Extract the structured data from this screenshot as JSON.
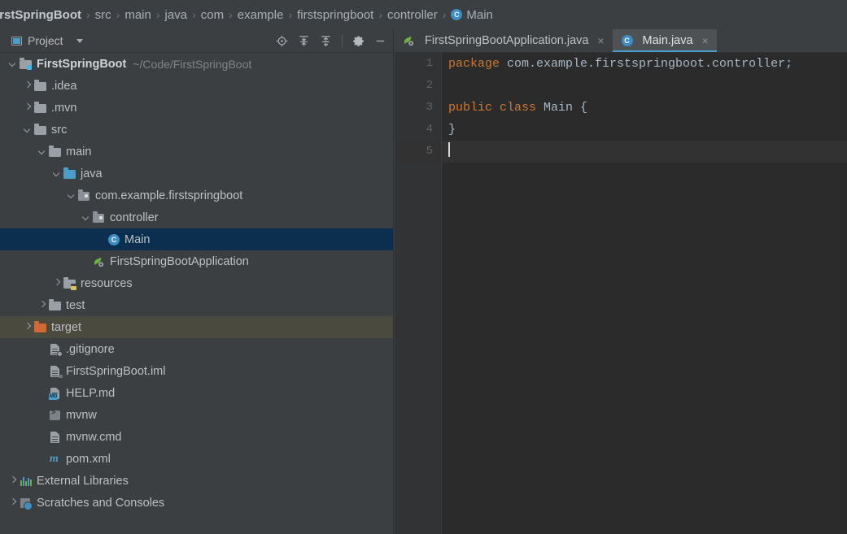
{
  "breadcrumb": {
    "items": [
      {
        "label": "irstSpringBoot",
        "icon": "none",
        "root": true
      },
      {
        "label": "src",
        "icon": "none"
      },
      {
        "label": "main",
        "icon": "none"
      },
      {
        "label": "java",
        "icon": "none"
      },
      {
        "label": "com",
        "icon": "none"
      },
      {
        "label": "example",
        "icon": "none"
      },
      {
        "label": "firstspringboot",
        "icon": "none"
      },
      {
        "label": "controller",
        "icon": "none"
      },
      {
        "label": "Main",
        "icon": "class-icon"
      }
    ],
    "separator": "›"
  },
  "sidebar": {
    "title": "Project",
    "caret_icon": "chevron-down-icon",
    "tools": [
      {
        "name": "locate-file-icon",
        "title": "Select Opened File"
      },
      {
        "name": "expand-all-icon",
        "title": "Expand All"
      },
      {
        "name": "collapse-all-icon",
        "title": "Collapse All"
      },
      {
        "name": "settings-gear-icon",
        "title": "Options"
      },
      {
        "name": "minimize-icon",
        "title": "Hide"
      }
    ],
    "tree": [
      {
        "label": "FirstSpringBoot",
        "hint": "~/Code/FirstSpringBoot",
        "indent": 0,
        "twisty": "down",
        "icon": "module-folder",
        "bold": true,
        "state": "normal"
      },
      {
        "label": ".idea",
        "hint": "",
        "indent": 1,
        "twisty": "right",
        "icon": "folder",
        "bold": false,
        "state": "normal"
      },
      {
        "label": ".mvn",
        "hint": "",
        "indent": 1,
        "twisty": "right",
        "icon": "folder",
        "bold": false,
        "state": "normal"
      },
      {
        "label": "src",
        "hint": "",
        "indent": 1,
        "twisty": "down",
        "icon": "folder",
        "bold": false,
        "state": "normal"
      },
      {
        "label": "main",
        "hint": "",
        "indent": 2,
        "twisty": "down",
        "icon": "folder",
        "bold": false,
        "state": "normal"
      },
      {
        "label": "java",
        "hint": "",
        "indent": 3,
        "twisty": "down",
        "icon": "source-folder",
        "bold": false,
        "state": "normal"
      },
      {
        "label": "com.example.firstspringboot",
        "hint": "",
        "indent": 4,
        "twisty": "down",
        "icon": "package",
        "bold": false,
        "state": "normal"
      },
      {
        "label": "controller",
        "hint": "",
        "indent": 5,
        "twisty": "down",
        "icon": "package",
        "bold": false,
        "state": "normal"
      },
      {
        "label": "Main",
        "hint": "",
        "indent": 6,
        "twisty": "none",
        "icon": "class-icon",
        "bold": false,
        "state": "selected"
      },
      {
        "label": "FirstSpringBootApplication",
        "hint": "",
        "indent": 5,
        "twisty": "none",
        "icon": "spring-boot-icon",
        "bold": false,
        "state": "normal"
      },
      {
        "label": "resources",
        "hint": "",
        "indent": 3,
        "twisty": "right",
        "icon": "resources-folder",
        "bold": false,
        "state": "normal"
      },
      {
        "label": "test",
        "hint": "",
        "indent": 2,
        "twisty": "right",
        "icon": "folder",
        "bold": false,
        "state": "normal"
      },
      {
        "label": "target",
        "hint": "",
        "indent": 1,
        "twisty": "right",
        "icon": "excluded-folder",
        "bold": false,
        "state": "excluded"
      },
      {
        "label": ".gitignore",
        "hint": "",
        "indent": 2,
        "twisty": "none",
        "icon": "gitignore-file",
        "bold": false,
        "state": "normal"
      },
      {
        "label": "FirstSpringBoot.iml",
        "hint": "",
        "indent": 2,
        "twisty": "none",
        "icon": "iml-file",
        "bold": false,
        "state": "normal"
      },
      {
        "label": "HELP.md",
        "hint": "",
        "indent": 2,
        "twisty": "none",
        "icon": "markdown-file",
        "bold": false,
        "state": "normal"
      },
      {
        "label": "mvnw",
        "hint": "",
        "indent": 2,
        "twisty": "none",
        "icon": "script-file",
        "bold": false,
        "state": "normal"
      },
      {
        "label": "mvnw.cmd",
        "hint": "",
        "indent": 2,
        "twisty": "none",
        "icon": "text-file",
        "bold": false,
        "state": "normal"
      },
      {
        "label": "pom.xml",
        "hint": "",
        "indent": 2,
        "twisty": "none",
        "icon": "maven-file",
        "bold": false,
        "state": "normal"
      },
      {
        "label": "External Libraries",
        "hint": "",
        "indent": 0,
        "twisty": "right",
        "icon": "libraries-icon",
        "bold": false,
        "state": "normal"
      },
      {
        "label": "Scratches and Consoles",
        "hint": "",
        "indent": 0,
        "twisty": "right",
        "icon": "scratches-icon",
        "bold": false,
        "state": "normal"
      }
    ]
  },
  "editor": {
    "tabs": [
      {
        "label": "FirstSpringBootApplication.java",
        "icon": "spring-boot-icon",
        "active": false,
        "close": "×"
      },
      {
        "label": "Main.java",
        "icon": "class-icon",
        "active": true,
        "close": "×"
      }
    ],
    "line_numbers": [
      "1",
      "2",
      "3",
      "4",
      "5"
    ],
    "lines": [
      {
        "n": "1",
        "tokens": [
          {
            "t": "package",
            "k": "kw"
          },
          {
            "t": " com.example.firstspringboot.controller;",
            "k": "plain"
          }
        ],
        "current": false
      },
      {
        "n": "2",
        "tokens": [],
        "current": false
      },
      {
        "n": "3",
        "tokens": [
          {
            "t": "public class",
            "k": "kw"
          },
          {
            "t": " Main {",
            "k": "plain"
          }
        ],
        "current": false
      },
      {
        "n": "4",
        "tokens": [
          {
            "t": "}",
            "k": "plain"
          }
        ],
        "current": false
      },
      {
        "n": "5",
        "tokens": [],
        "current": true
      }
    ]
  },
  "colors": {
    "sidebar_bg": "#3c3f41",
    "editor_bg": "#2b2b2b",
    "gutter_bg": "#313335",
    "selection_bg": "#0d2f4f",
    "excluded_bg": "#4b4a3e",
    "accent": "#4a9ec9",
    "keyword": "#cc7832",
    "text": "#a9b7c6"
  }
}
